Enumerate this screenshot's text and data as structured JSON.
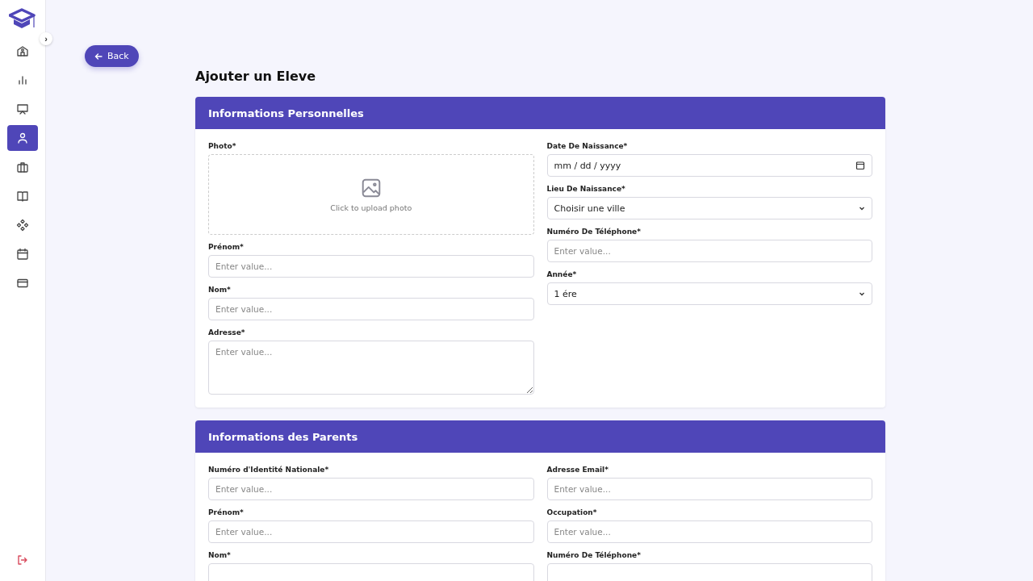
{
  "sidebar": {
    "items": [
      {
        "selected": false
      },
      {
        "selected": false
      },
      {
        "selected": false
      },
      {
        "selected": true
      },
      {
        "selected": false
      },
      {
        "selected": false
      },
      {
        "selected": false
      },
      {
        "selected": false
      },
      {
        "selected": false
      }
    ],
    "collapse_toggle": "›"
  },
  "back_button": {
    "label": "Back"
  },
  "title": "Ajouter un Eleve",
  "sections": [
    {
      "title": "Informations Personnelles",
      "columns": [
        [
          {
            "label": "Photo*",
            "kind": "file",
            "hint": "Click to upload photo"
          },
          {
            "label": "Prénom*",
            "kind": "text",
            "placeholder": "Enter value..."
          },
          {
            "label": "Nom*",
            "kind": "text",
            "placeholder": "Enter value..."
          },
          {
            "label": "Adresse*",
            "kind": "textarea",
            "placeholder": "Enter value..."
          }
        ],
        [
          {
            "label": "Date De Naissance*",
            "kind": "date",
            "value": "mm / dd / yyyy"
          },
          {
            "label": "Lieu De Naissance*",
            "kind": "select",
            "value": "Choisir une ville"
          },
          {
            "label": "Numéro De Téléphone*",
            "kind": "text",
            "placeholder": "Enter value..."
          },
          {
            "label": "Année*",
            "kind": "select",
            "value": "1 ére"
          }
        ]
      ]
    },
    {
      "title": "Informations des Parents",
      "columns": [
        [
          {
            "label": "Numéro d'Identité Nationale*",
            "kind": "text",
            "placeholder": "Enter value..."
          },
          {
            "label": "Prénom*",
            "kind": "text",
            "placeholder": "Enter value..."
          },
          {
            "label": "Nom*",
            "kind": "text"
          }
        ],
        [
          {
            "label": "Adresse Email*",
            "kind": "text",
            "placeholder": "Enter value..."
          },
          {
            "label": "Occupation*",
            "kind": "text",
            "placeholder": "Enter value..."
          },
          {
            "label": "Numéro De Téléphone*",
            "kind": "text"
          }
        ]
      ]
    }
  ]
}
